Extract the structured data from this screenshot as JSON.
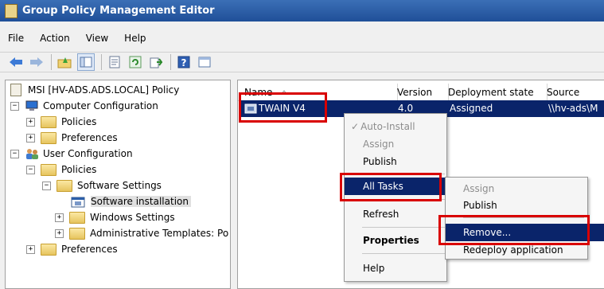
{
  "window": {
    "title": "Group Policy Management Editor"
  },
  "menubar": [
    "File",
    "Action",
    "View",
    "Help"
  ],
  "toolbar": {
    "icons": [
      "back-arrow-icon",
      "forward-arrow-icon",
      "up-folder-icon",
      "show-hide-tree-icon",
      "properties-icon",
      "refresh-icon",
      "export-list-icon",
      "help-icon",
      "console-icon"
    ]
  },
  "tree": {
    "root": "MSI [HV-ADS.ADS.LOCAL] Policy",
    "computer_config": "Computer Configuration",
    "cc_policies": "Policies",
    "cc_preferences": "Preferences",
    "user_config": "User Configuration",
    "uc_policies": "Policies",
    "software_settings": "Software Settings",
    "software_installation": "Software installation",
    "windows_settings": "Windows Settings",
    "admin_templates": "Administrative Templates: Po",
    "uc_preferences": "Preferences"
  },
  "list": {
    "columns": [
      "Name",
      "Version",
      "Deployment state",
      "Source"
    ],
    "rows": [
      {
        "name": "TWAIN V4",
        "version": "4.0",
        "state": "Assigned",
        "source": "\\\\hv-ads\\M"
      }
    ]
  },
  "context_menu": {
    "auto_install": "Auto-Install",
    "assign": "Assign",
    "publish": "Publish",
    "all_tasks": "All Tasks",
    "refresh": "Refresh",
    "properties": "Properties",
    "help": "Help"
  },
  "submenu": {
    "assign": "Assign",
    "publish": "Publish",
    "remove": "Remove...",
    "redeploy": "Redeploy application"
  },
  "colors": {
    "highlight": "#0a246a",
    "callout": "#d90000",
    "title_bar": "#2a5ca6"
  }
}
